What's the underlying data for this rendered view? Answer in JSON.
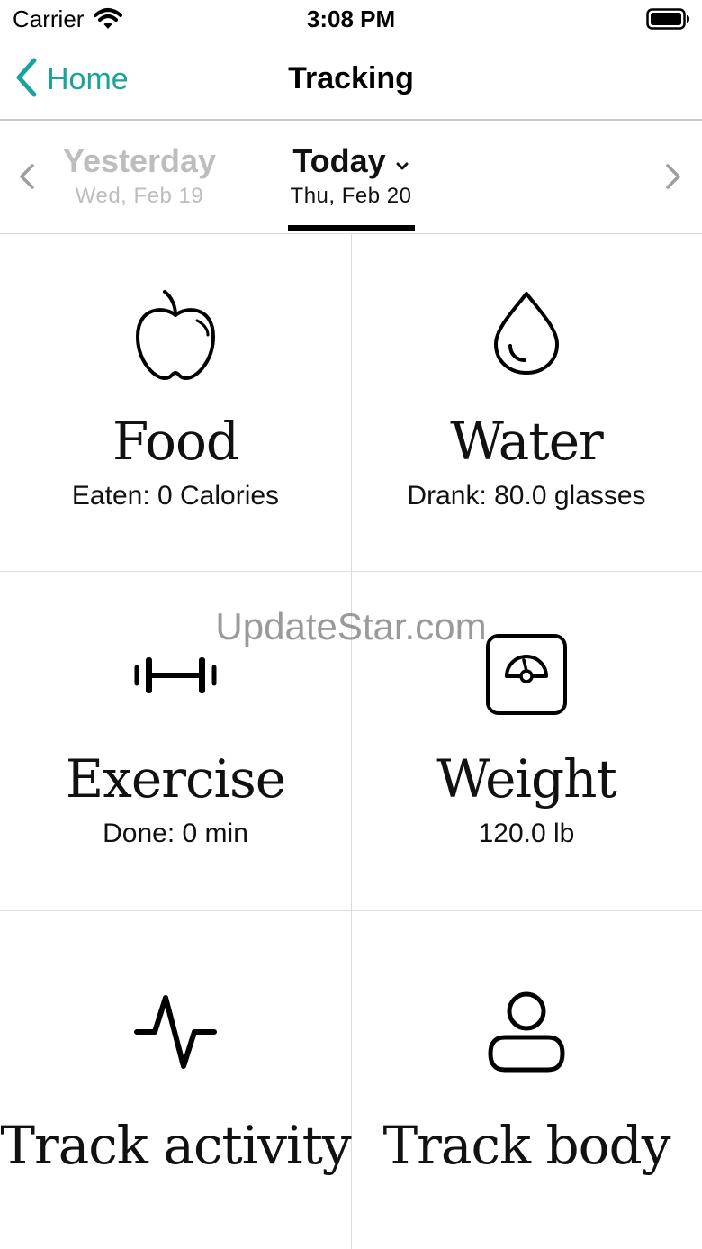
{
  "status_bar": {
    "carrier": "Carrier",
    "time": "3:08 PM"
  },
  "nav": {
    "back_label": "Home",
    "title": "Tracking"
  },
  "dates": {
    "yesterday": {
      "label": "Yesterday",
      "date": "Wed, Feb 19"
    },
    "today": {
      "label": "Today",
      "date": "Thu, Feb 20"
    }
  },
  "tiles": [
    {
      "icon": "apple-icon",
      "title": "Food",
      "subtitle": "Eaten: 0 Calories"
    },
    {
      "icon": "water-drop-icon",
      "title": "Water",
      "subtitle": "Drank: 80.0 glasses"
    },
    {
      "icon": "dumbbell-icon",
      "title": "Exercise",
      "subtitle": "Done: 0 min"
    },
    {
      "icon": "scale-icon",
      "title": "Weight",
      "subtitle": "120.0 lb"
    },
    {
      "icon": "activity-pulse-icon",
      "title": "Track activity"
    },
    {
      "icon": "person-icon",
      "title": "Track body"
    }
  ],
  "watermark": "UpdateStar.com",
  "colors": {
    "accent": "#1aa39b",
    "inactive": "#bdbdbd",
    "divider": "#dcdcdc"
  }
}
